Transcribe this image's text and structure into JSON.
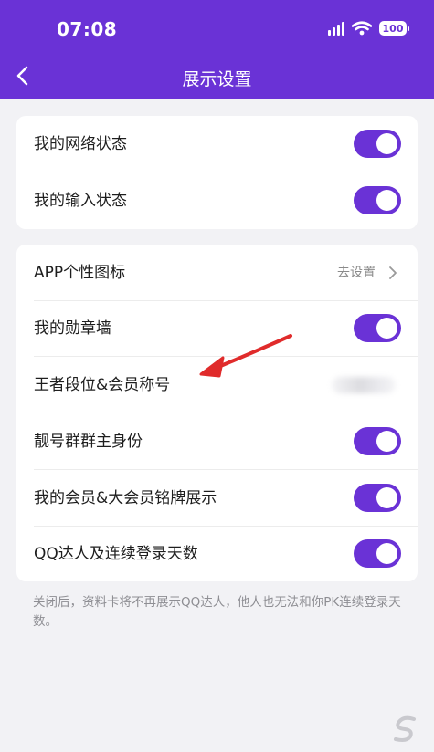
{
  "status_bar": {
    "time": "07:08",
    "battery": "100"
  },
  "header": {
    "title": "展示设置"
  },
  "group1": {
    "items": [
      {
        "label": "我的网络状态",
        "toggle_on": true
      },
      {
        "label": "我的输入状态",
        "toggle_on": true
      }
    ]
  },
  "group2": {
    "app_icon": {
      "label": "APP个性图标",
      "action": "去设置"
    },
    "items": [
      {
        "label": "我的勋章墙",
        "toggle_on": true
      },
      {
        "label": "王者段位&会员称号"
      },
      {
        "label": "靓号群群主身份",
        "toggle_on": true
      },
      {
        "label": "我的会员&大会员铭牌展示",
        "toggle_on": true
      },
      {
        "label": "QQ达人及连续登录天数",
        "toggle_on": true
      }
    ]
  },
  "footnote": "关闭后，资料卡将不再展示QQ达人，他人也无法和你PK连续登录天数。",
  "colors": {
    "accent": "#6a32d6",
    "annotation_arrow": "#e02b2b"
  },
  "icons": [
    "back-chevron-icon",
    "signal-icon",
    "wifi-icon",
    "battery-icon",
    "chevron-right-icon"
  ]
}
